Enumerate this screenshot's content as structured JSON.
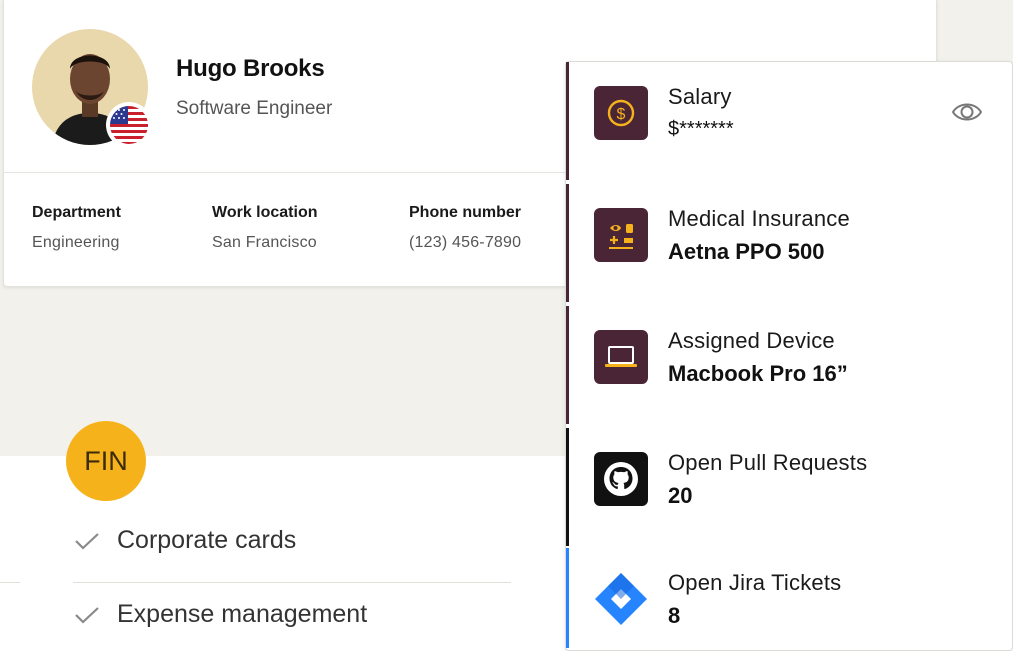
{
  "profile": {
    "name": "Hugo Brooks",
    "role": "Software Engineer",
    "flag_icon": "us-flag-icon",
    "details": [
      {
        "label": "Department",
        "value": "Engineering"
      },
      {
        "label": "Work location",
        "value": "San Francisco"
      },
      {
        "label": "Phone number",
        "value": "(123) 456-7890"
      }
    ]
  },
  "fin": {
    "badge": "FIN",
    "features": [
      "Corporate cards",
      "Expense management"
    ]
  },
  "info_panel": {
    "rows": [
      {
        "label": "Salary",
        "value": "$*******",
        "icon": "dollar-coin-icon"
      },
      {
        "label": "Medical Insurance",
        "value": "Aetna PPO 500",
        "icon": "medical-icon"
      },
      {
        "label": "Assigned Device",
        "value": "Macbook Pro 16”",
        "icon": "laptop-icon"
      },
      {
        "label": "Open Pull Requests",
        "value": "20",
        "icon": "github-icon"
      },
      {
        "label": "Open Jira Tickets",
        "value": "8",
        "icon": "jira-icon"
      }
    ]
  },
  "colors": {
    "background": "#f2f1eb",
    "tile_plum": "#4a2535",
    "tile_accent_gold": "#f6b21b",
    "github_black": "#111111",
    "jira_blue": "#2684ff",
    "fin_badge": "#f6b21b"
  }
}
